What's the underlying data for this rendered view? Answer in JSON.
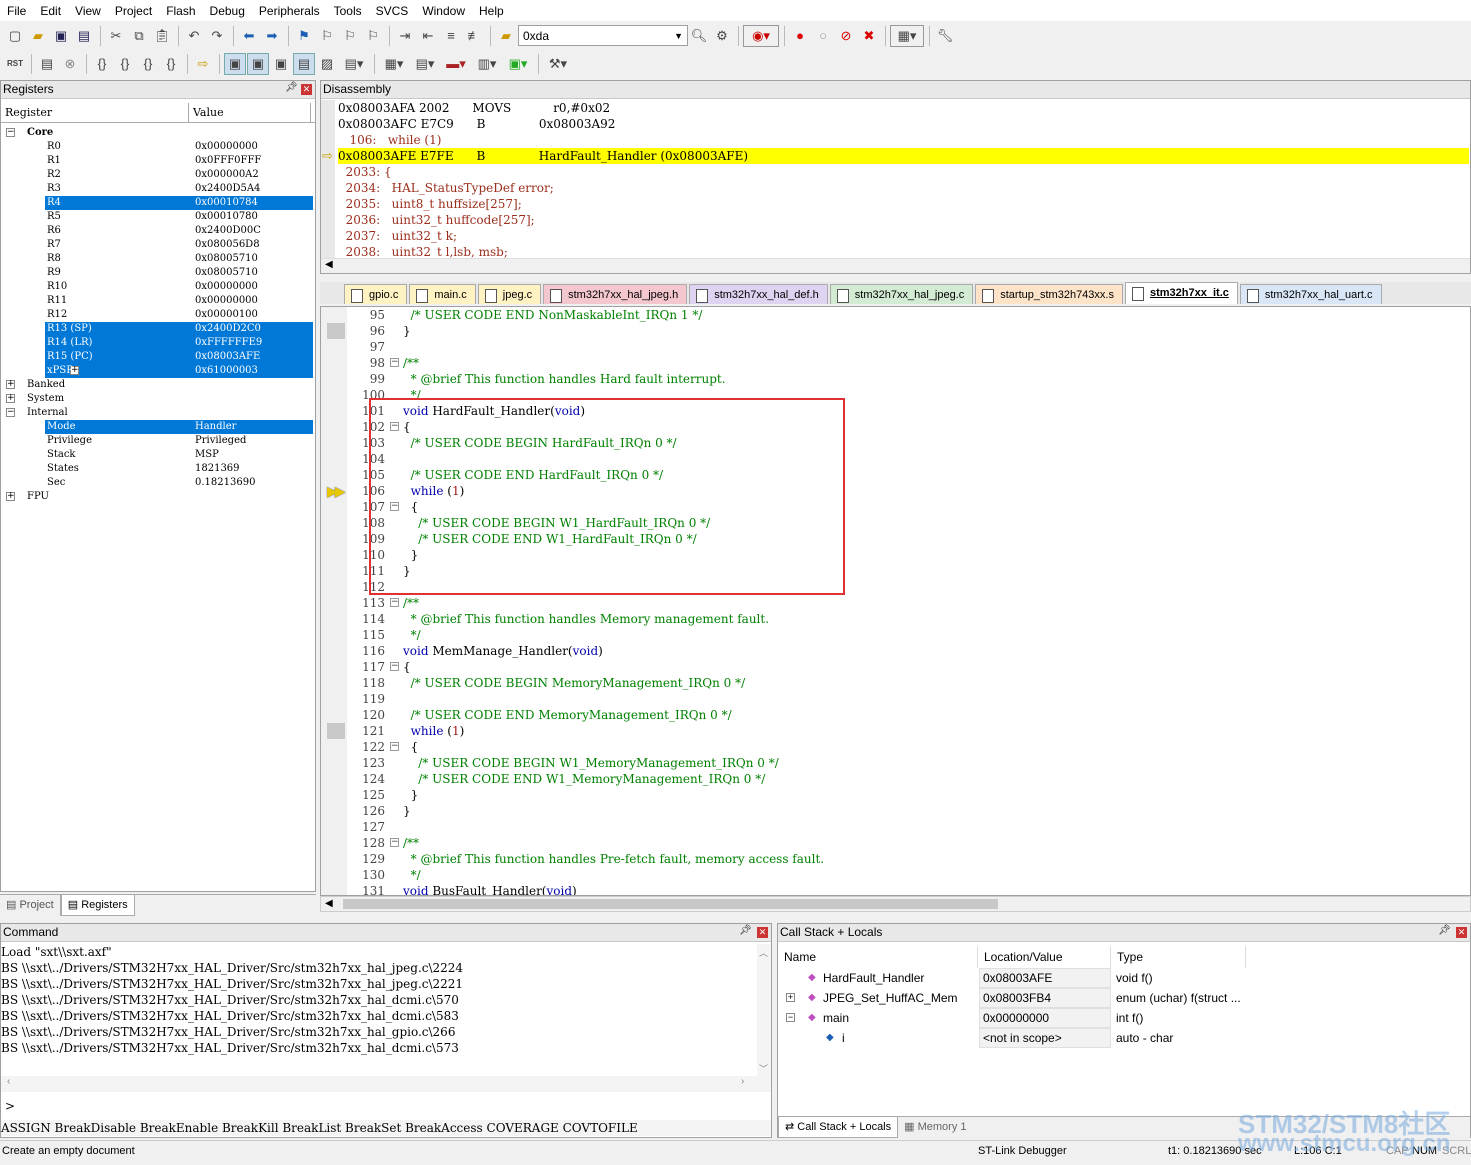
{
  "menu": [
    "File",
    "Edit",
    "View",
    "Project",
    "Flash",
    "Debug",
    "Peripherals",
    "Tools",
    "SVCS",
    "Window",
    "Help"
  ],
  "toolbar": {
    "target_combo": "0xda"
  },
  "registers": {
    "title": "Registers",
    "col_register": "Register",
    "col_value": "Value",
    "rows": [
      {
        "name": "Core",
        "value": "",
        "level": 0,
        "expander": "−",
        "bold": true
      },
      {
        "name": "R0",
        "value": "0x00000000",
        "level": 2
      },
      {
        "name": "R1",
        "value": "0x0FFF0FFF",
        "level": 2
      },
      {
        "name": "R2",
        "value": "0x000000A2",
        "level": 2
      },
      {
        "name": "R3",
        "value": "0x2400D5A4",
        "level": 2
      },
      {
        "name": "R4",
        "value": "0x00010784",
        "level": 2,
        "selected": true
      },
      {
        "name": "R5",
        "value": "0x00010780",
        "level": 2
      },
      {
        "name": "R6",
        "value": "0x2400D00C",
        "level": 2
      },
      {
        "name": "R7",
        "value": "0x080056D8",
        "level": 2
      },
      {
        "name": "R8",
        "value": "0x08005710",
        "level": 2
      },
      {
        "name": "R9",
        "value": "0x08005710",
        "level": 2
      },
      {
        "name": "R10",
        "value": "0x00000000",
        "level": 2
      },
      {
        "name": "R11",
        "value": "0x00000000",
        "level": 2
      },
      {
        "name": "R12",
        "value": "0x00000100",
        "level": 2
      },
      {
        "name": "R13 (SP)",
        "value": "0x2400D2C0",
        "level": 2,
        "selected": true
      },
      {
        "name": "R14 (LR)",
        "value": "0xFFFFFFE9",
        "level": 2,
        "selected": true
      },
      {
        "name": "R15 (PC)",
        "value": "0x08003AFE",
        "level": 2,
        "selected": true
      },
      {
        "name": "xPSR",
        "value": "0x61000003",
        "level": 2,
        "selected": true,
        "expander": "+"
      },
      {
        "name": "Banked",
        "value": "",
        "level": 0,
        "expander": "+"
      },
      {
        "name": "System",
        "value": "",
        "level": 0,
        "expander": "+"
      },
      {
        "name": "Internal",
        "value": "",
        "level": 0,
        "expander": "−"
      },
      {
        "name": "Mode",
        "value": "Handler",
        "level": 2,
        "selected": true
      },
      {
        "name": "Privilege",
        "value": "Privileged",
        "level": 2
      },
      {
        "name": "Stack",
        "value": "MSP",
        "level": 2
      },
      {
        "name": "States",
        "value": "1821369",
        "level": 2
      },
      {
        "name": "Sec",
        "value": "0.18213690",
        "level": 2
      },
      {
        "name": "FPU",
        "value": "",
        "level": 0,
        "expander": "+"
      }
    ],
    "bottom_tabs": [
      "Project",
      "Registers"
    ]
  },
  "disassembly": {
    "title": "Disassembly",
    "lines": [
      {
        "text": "0x08003AFA 2002      MOVS           r0,#0x02",
        "type": "asm"
      },
      {
        "text": "0x08003AFC E7C9      B              0x08003A92",
        "type": "asm"
      },
      {
        "text": "   106:   while (1)",
        "type": "src"
      },
      {
        "text": "0x08003AFE E7FE      B              HardFault_Handler (0x08003AFE)",
        "type": "current"
      },
      {
        "text": "  2033: {",
        "type": "src"
      },
      {
        "text": "  2034:   HAL_StatusTypeDef error;",
        "type": "src"
      },
      {
        "text": "  2035:   uint8_t huffsize[257];",
        "type": "src"
      },
      {
        "text": "  2036:   uint32_t huffcode[257];",
        "type": "src"
      },
      {
        "text": "  2037:   uint32_t k;",
        "type": "src"
      },
      {
        "text": "  2038:   uint32_t l,lsb, msb;",
        "type": "src"
      }
    ]
  },
  "file_tabs": [
    {
      "label": "gpio.c",
      "color": "#fff3c4"
    },
    {
      "label": "main.c",
      "color": "#fff3c4"
    },
    {
      "label": "jpeg.c",
      "color": "#fff3c4"
    },
    {
      "label": "stm32h7xx_hal_jpeg.h",
      "color": "#f4c7cf"
    },
    {
      "label": "stm32h7xx_hal_def.h",
      "color": "#ded3f0"
    },
    {
      "label": "stm32h7xx_hal_jpeg.c",
      "color": "#d3ead3"
    },
    {
      "label": "startup_stm32h743xx.s",
      "color": "#fde3c8"
    },
    {
      "label": "stm32h7xx_it.c",
      "color": "#ffffff",
      "active": true
    },
    {
      "label": "stm32h7xx_hal_uart.c",
      "color": "#d9e6f5"
    }
  ],
  "editor": {
    "lines": [
      {
        "n": "95",
        "code": "  /* USER CODE END NonMaskableInt_IRQn 1 */",
        "cls": "cm"
      },
      {
        "n": "96",
        "code": "}",
        "cls": ""
      },
      {
        "n": "97",
        "code": "",
        "cls": ""
      },
      {
        "n": "98",
        "code": "/**",
        "cls": "cm",
        "fold": "−"
      },
      {
        "n": "99",
        "code": "  * @brief This function handles Hard fault interrupt.",
        "cls": "cm"
      },
      {
        "n": "100",
        "code": "  */",
        "cls": "cm"
      },
      {
        "n": "101",
        "code": "void HardFault_Handler(void)",
        "cls": "fn"
      },
      {
        "n": "102",
        "code": "{",
        "cls": "",
        "fold": "−"
      },
      {
        "n": "103",
        "code": "  /* USER CODE BEGIN HardFault_IRQn 0 */",
        "cls": "cm"
      },
      {
        "n": "104",
        "code": "",
        "cls": ""
      },
      {
        "n": "105",
        "code": "  /* USER CODE END HardFault_IRQn 0 */",
        "cls": "cm"
      },
      {
        "n": "106",
        "code": "  while (1)",
        "cls": "wh"
      },
      {
        "n": "107",
        "code": "  {",
        "cls": "",
        "fold": "−"
      },
      {
        "n": "108",
        "code": "    /* USER CODE BEGIN W1_HardFault_IRQn 0 */",
        "cls": "cm"
      },
      {
        "n": "109",
        "code": "    /* USER CODE END W1_HardFault_IRQn 0 */",
        "cls": "cm"
      },
      {
        "n": "110",
        "code": "  }",
        "cls": ""
      },
      {
        "n": "111",
        "code": "}",
        "cls": ""
      },
      {
        "n": "112",
        "code": "",
        "cls": ""
      },
      {
        "n": "113",
        "code": "/**",
        "cls": "cm",
        "fold": "−"
      },
      {
        "n": "114",
        "code": "  * @brief This function handles Memory management fault.",
        "cls": "cm"
      },
      {
        "n": "115",
        "code": "  */",
        "cls": "cm"
      },
      {
        "n": "116",
        "code": "void MemManage_Handler(void)",
        "cls": "fn"
      },
      {
        "n": "117",
        "code": "{",
        "cls": "",
        "fold": "−"
      },
      {
        "n": "118",
        "code": "  /* USER CODE BEGIN MemoryManagement_IRQn 0 */",
        "cls": "cm"
      },
      {
        "n": "119",
        "code": "",
        "cls": ""
      },
      {
        "n": "120",
        "code": "  /* USER CODE END MemoryManagement_IRQn 0 */",
        "cls": "cm"
      },
      {
        "n": "121",
        "code": "  while (1)",
        "cls": "wh"
      },
      {
        "n": "122",
        "code": "  {",
        "cls": "",
        "fold": "−"
      },
      {
        "n": "123",
        "code": "    /* USER CODE BEGIN W1_MemoryManagement_IRQn 0 */",
        "cls": "cm"
      },
      {
        "n": "124",
        "code": "    /* USER CODE END W1_MemoryManagement_IRQn 0 */",
        "cls": "cm"
      },
      {
        "n": "125",
        "code": "  }",
        "cls": ""
      },
      {
        "n": "126",
        "code": "}",
        "cls": ""
      },
      {
        "n": "127",
        "code": "",
        "cls": ""
      },
      {
        "n": "128",
        "code": "/**",
        "cls": "cm",
        "fold": "−"
      },
      {
        "n": "129",
        "code": "  * @brief This function handles Pre-fetch fault, memory access fault.",
        "cls": "cm"
      },
      {
        "n": "130",
        "code": "  */",
        "cls": "cm"
      },
      {
        "n": "131",
        "code": "void BusFault_Handler(void)",
        "cls": "fn"
      }
    ]
  },
  "command": {
    "title": "Command",
    "lines": [
      "Load \"sxt\\\\sxt.axf\"",
      "BS \\\\sxt\\../Drivers/STM32H7xx_HAL_Driver/Src/stm32h7xx_hal_jpeg.c\\2224",
      "BS \\\\sxt\\../Drivers/STM32H7xx_HAL_Driver/Src/stm32h7xx_hal_jpeg.c\\2221",
      "BS \\\\sxt\\../Drivers/STM32H7xx_HAL_Driver/Src/stm32h7xx_hal_dcmi.c\\570",
      "BS \\\\sxt\\../Drivers/STM32H7xx_HAL_Driver/Src/stm32h7xx_hal_dcmi.c\\583",
      "BS \\\\sxt\\../Drivers/STM32H7xx_HAL_Driver/Src/stm32h7xx_hal_gpio.c\\266",
      "BS \\\\sxt\\../Drivers/STM32H7xx_HAL_Driver/Src/stm32h7xx_hal_dcmi.c\\573"
    ],
    "prompt": ">",
    "hints": "ASSIGN BreakDisable BreakEnable BreakKill BreakList BreakSet BreakAccess COVERAGE COVTOFILE"
  },
  "callstack": {
    "title": "Call Stack + Locals",
    "col_name": "Name",
    "col_location": "Location/Value",
    "col_type": "Type",
    "rows": [
      {
        "name": "HardFault_Handler",
        "loc": "0x08003AFE",
        "type": "void f()",
        "indent": 0,
        "expander": ""
      },
      {
        "name": "JPEG_Set_HuffAC_Mem",
        "loc": "0x08003FB4",
        "type": "enum (uchar) f(struct ...",
        "indent": 0,
        "expander": "+"
      },
      {
        "name": "main",
        "loc": "0x00000000",
        "type": "int f()",
        "indent": 0,
        "expander": "−"
      },
      {
        "name": "i",
        "loc": "<not in scope>",
        "type": "auto - char",
        "indent": 1,
        "expander": ""
      }
    ],
    "bottom_tabs": [
      "Call Stack + Locals",
      "Memory 1"
    ]
  },
  "status": {
    "left": "Create an empty document",
    "debugger": "ST-Link Debugger",
    "time": "t1: 0.18213690 sec",
    "position": "L:106 C:1",
    "caps": "CAP",
    "num": "NUM",
    "scrl": "SCRL"
  },
  "watermark": {
    "line1": "STM32/STM8社区",
    "line2": "www.stmcu.org.cn"
  }
}
